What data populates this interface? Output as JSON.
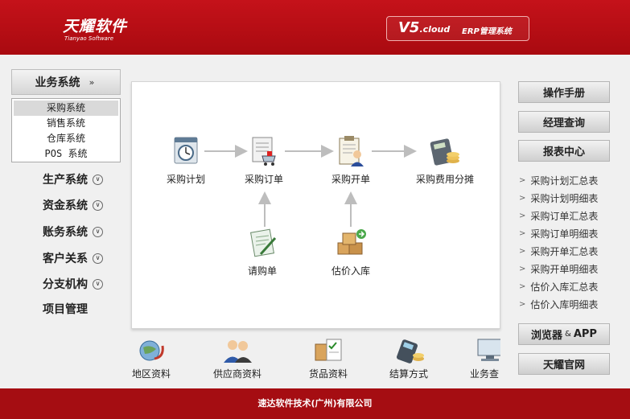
{
  "header": {
    "logo_main": "天耀软件",
    "logo_sub": "Tianyao Software",
    "version_main": "V5",
    "version_cloud": ".cloud",
    "version_sub": "ERP管理系统"
  },
  "sidebar": {
    "head_label": "业务系统",
    "sub_items": [
      "采购系统",
      "销售系统",
      "仓库系统",
      "POS 系统"
    ],
    "items": [
      {
        "label": "生产系统"
      },
      {
        "label": "资金系统"
      },
      {
        "label": "账务系统"
      },
      {
        "label": "客户关系"
      },
      {
        "label": "分支机构"
      },
      {
        "label": "项目管理"
      }
    ]
  },
  "flow": {
    "nodes": [
      {
        "label": "采购计划"
      },
      {
        "label": "采购订单"
      },
      {
        "label": "采购开单"
      },
      {
        "label": "采购费用分摊"
      },
      {
        "label": "请购单"
      },
      {
        "label": "估价入库"
      }
    ]
  },
  "bottom_icons": [
    {
      "label": "地区资料"
    },
    {
      "label": "供应商资料"
    },
    {
      "label": "货品资料"
    },
    {
      "label": "结算方式"
    },
    {
      "label": "业务查"
    }
  ],
  "right": {
    "buttons": [
      "操作手册",
      "经理查询",
      "报表中心"
    ],
    "reports": [
      "采购计划汇总表",
      "采购计划明细表",
      "采购订单汇总表",
      "采购订单明细表",
      "采购开单汇总表",
      "采购开单明细表",
      "估价入库汇总表",
      "估价入库明细表"
    ],
    "browser_btn": "浏览器",
    "browser_amp": "&",
    "browser_app": "APP",
    "official_btn": "天耀官网"
  },
  "footer": {
    "company": "速达软件技术(广州)有限公司"
  },
  "colors": {
    "brand_red": "#b00e14",
    "footer_red": "#a50d12"
  }
}
